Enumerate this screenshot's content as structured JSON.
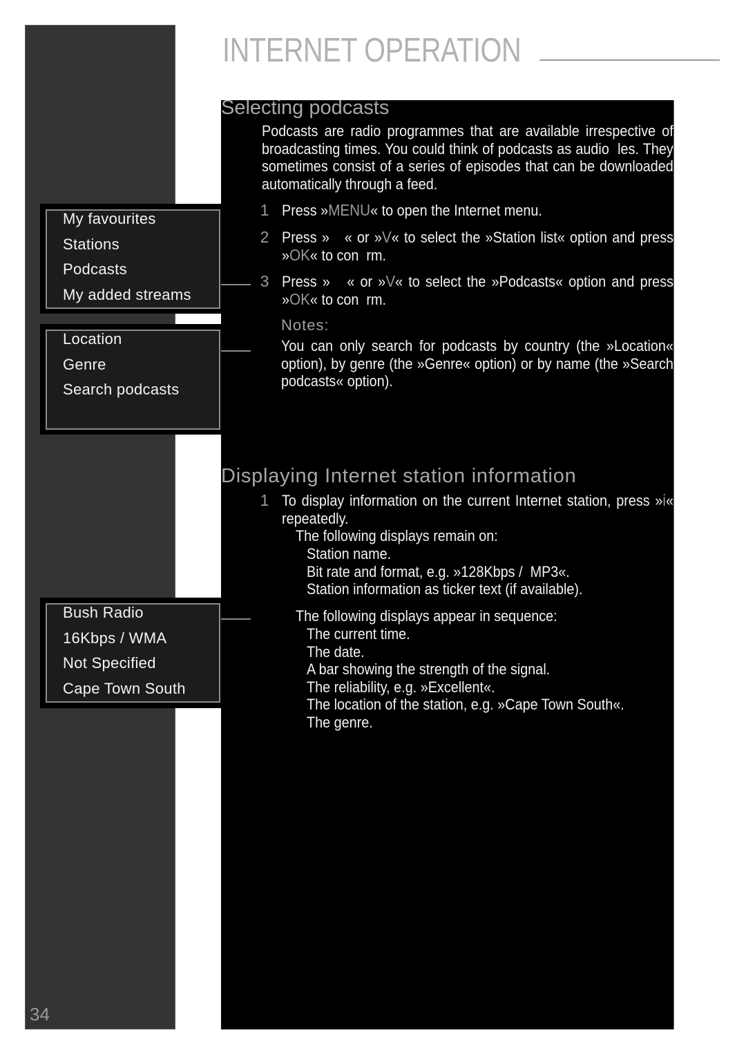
{
  "header": {
    "title": "INTERNET OPERATION"
  },
  "page_number": "34",
  "screens": {
    "internet_menu": {
      "items": [
        "My favourites",
        "Stations",
        "Podcasts",
        "My added streams"
      ]
    },
    "podcasts_menu": {
      "items": [
        "Location",
        "Genre",
        "Search podcasts"
      ]
    },
    "station_info": {
      "items": [
        "Bush Radio",
        "16Kbps / WMA",
        "Not Specified",
        "Cape Town South"
      ]
    }
  },
  "selecting": {
    "heading": "Selecting podcasts",
    "intro_lines": [
      "Podcasts are radio programmes that are available irrespective of",
      "broadcasting times. You could think of podcasts as audio  les. They",
      "sometimes consist of a series of episodes that can be downloaded",
      "automatically through a feed."
    ],
    "steps": [
      {
        "num": "1",
        "lines": [
          [
            "Press »",
            "MENU",
            "« to open the Internet menu."
          ]
        ]
      },
      {
        "num": "2",
        "lines": [
          [
            "Press »   « or »",
            "V",
            "« to select the »Station list« option and press"
          ],
          [
            "»",
            "OK",
            "« to con  rm."
          ]
        ]
      },
      {
        "num": "3",
        "lines": [
          [
            "Press »   « or »",
            "V",
            "« to select the »Podcasts« option and press"
          ],
          [
            "»",
            "OK",
            "« to con  rm."
          ]
        ]
      }
    ],
    "notes_label": "Notes:",
    "notes_lines": [
      "You can only search for podcasts by country (the »Location«",
      "option), by genre (the »Genre« option) or by name (the »Search",
      "podcasts« option)."
    ]
  },
  "displaying": {
    "heading": "Displaying Internet station information",
    "steps": [
      {
        "num": "1",
        "lines": [
          [
            "To display information on the current Internet station, press »",
            "i",
            "«"
          ],
          [
            "repeatedly."
          ]
        ]
      }
    ],
    "remain_label": "The following displays remain on:",
    "remain_items": [
      "Station name.",
      "Bit rate and format, e.g. »128Kbps /  MP3«.",
      "Station information as ticker text (if available)."
    ],
    "sequence_label": "The following displays appear in sequence:",
    "sequence_items": [
      "The current time.",
      "The date.",
      "A bar showing the strength of the signal.",
      "The reliability, e.g. »Excellent«.",
      "The location of the station, e.g. »Cape Town South«.",
      "The genre."
    ]
  },
  "colors": {
    "sidebar": "#333333",
    "panel": "#000000",
    "screen_fill": "#1c1c1c",
    "screen_border": "#8c8c8c",
    "heading_gray": "#a8a8a8",
    "key_gray": "#9a9a9a",
    "body_text": "#f2f2f2"
  }
}
